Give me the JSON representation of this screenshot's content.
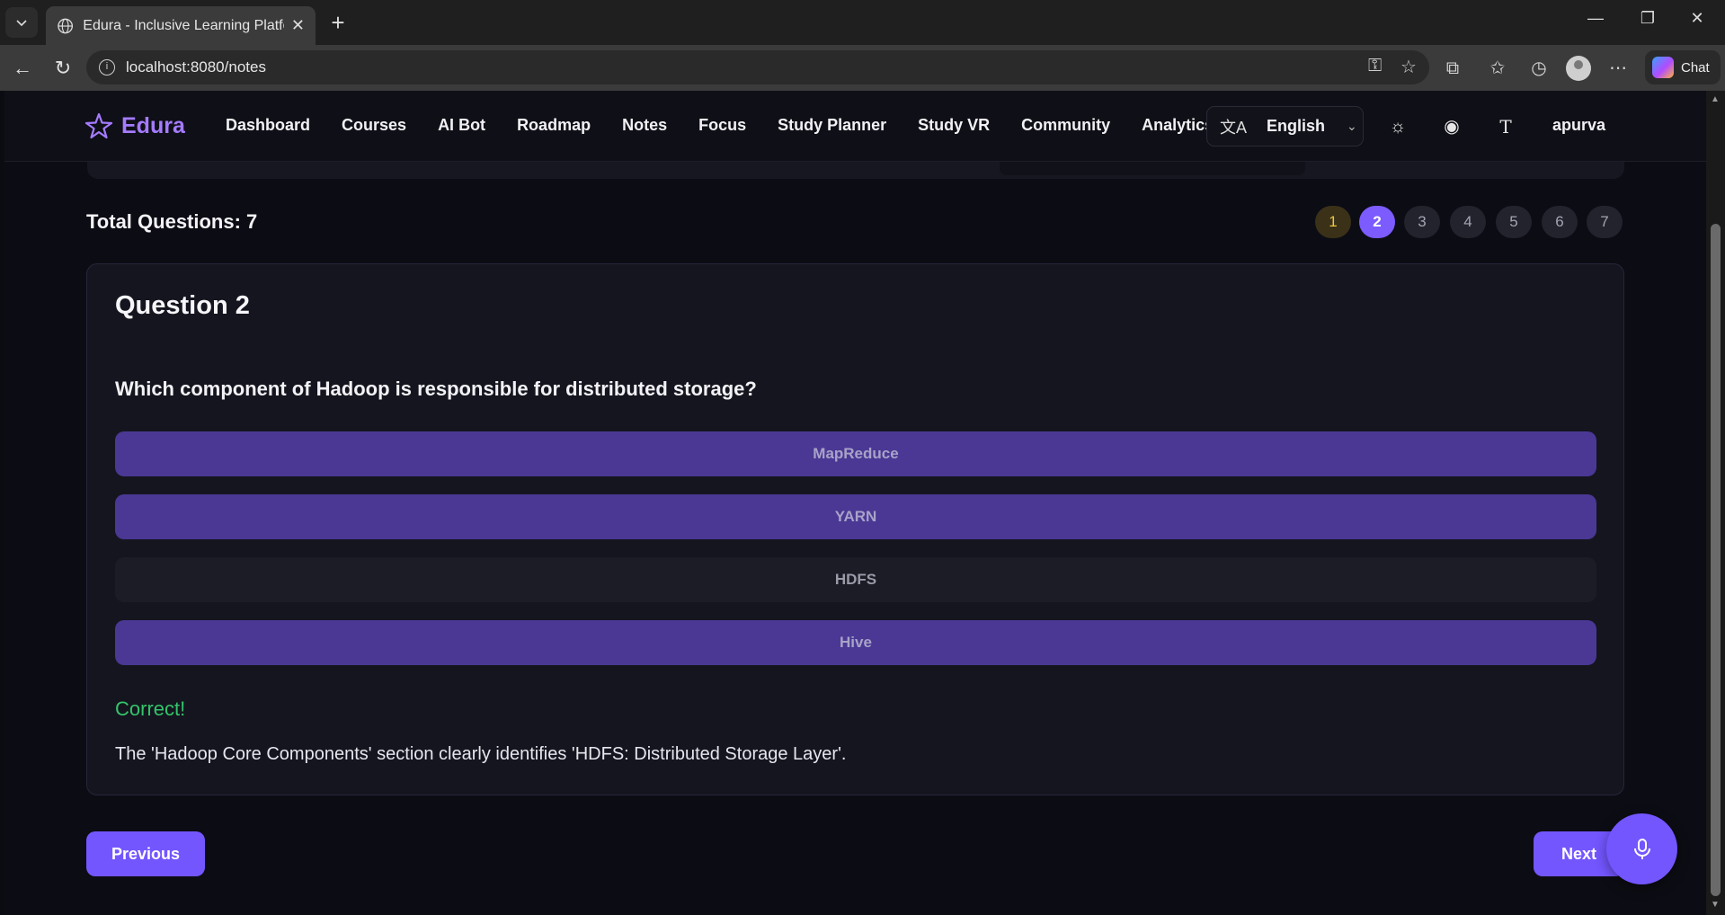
{
  "browser": {
    "tab_title": "Edura - Inclusive Learning Platform",
    "url": "localhost:8080/notes",
    "chat_label": "Chat"
  },
  "app": {
    "brand": "Edura",
    "nav": [
      "Dashboard",
      "Courses",
      "AI Bot",
      "Roadmap",
      "Notes",
      "Focus",
      "Study Planner",
      "Study VR",
      "Community",
      "Analytics"
    ],
    "language": "English",
    "user": "apurva"
  },
  "quiz": {
    "total_label": "Total Questions: 7",
    "question_numbers": [
      "1",
      "2",
      "3",
      "4",
      "5",
      "6",
      "7"
    ],
    "answered": [
      "1"
    ],
    "current": "2",
    "question_title": "Question 2",
    "question_text": "Which component of Hadoop is responsible for distributed storage?",
    "options": [
      "MapReduce",
      "YARN",
      "HDFS",
      "Hive"
    ],
    "correct_option": "HDFS",
    "feedback": "Correct!",
    "explanation": "The 'Hadoop Core Components' section clearly identifies 'HDFS: Distributed Storage Layer'."
  },
  "buttons": {
    "previous": "Previous",
    "next": "Next"
  },
  "colors": {
    "accent": "#7456ff",
    "brand": "#a57bff",
    "correct": "#34c46b",
    "answered": "#f2c441"
  }
}
